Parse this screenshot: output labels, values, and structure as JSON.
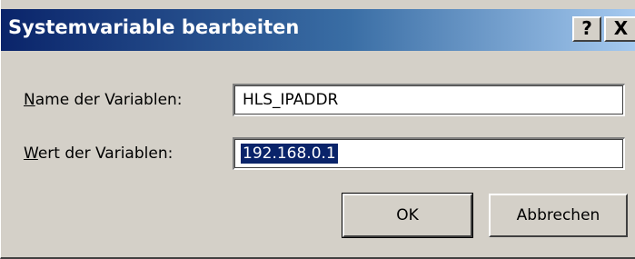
{
  "window": {
    "title": "Systemvariable bearbeiten",
    "help_button": "?",
    "close_button": "X"
  },
  "form": {
    "name_label_mnemonic": "N",
    "name_label_rest": "ame der Variablen:",
    "name_value": "HLS_IPADDR",
    "value_label_mnemonic": "W",
    "value_label_rest": "ert der Variablen:",
    "value_value": "192.168.0.1"
  },
  "buttons": {
    "ok": "OK",
    "cancel": "Abbrechen"
  },
  "colors": {
    "titlebar_start": "#0a246a",
    "titlebar_end": "#a6caf0",
    "dialog_bg": "#d4d0c8",
    "selection": "#0a246a"
  },
  "icons": {
    "help": "help-icon",
    "close": "close-icon"
  }
}
